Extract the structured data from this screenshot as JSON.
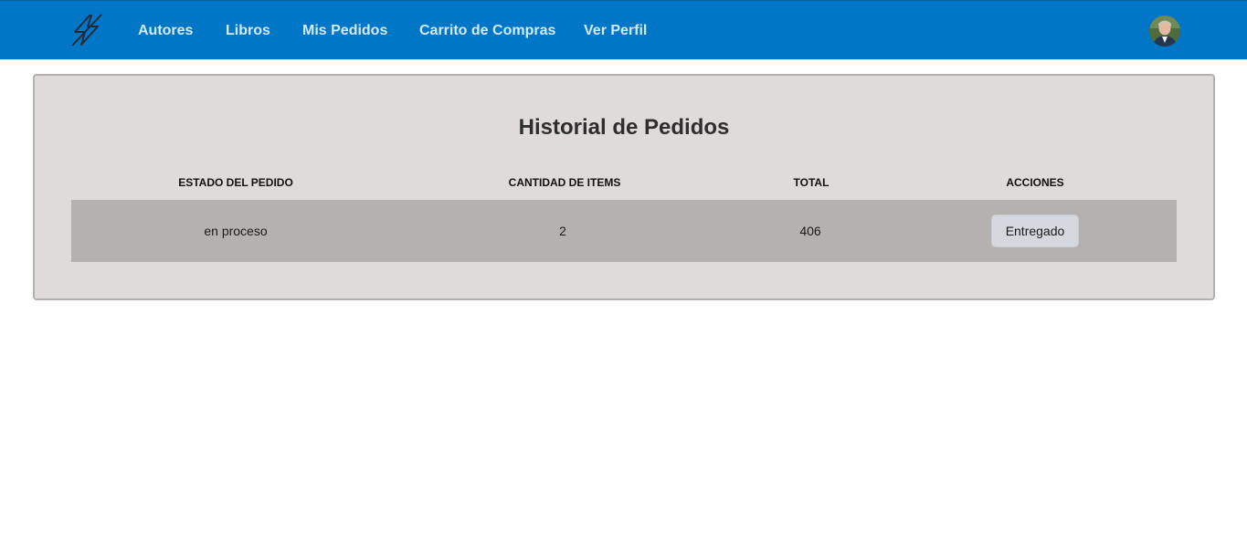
{
  "nav": {
    "logo_icon": "lightning-bolt-icon",
    "links": [
      "Autores",
      "Libros",
      "Mis Pedidos",
      "Carrito de Compras",
      "Ver Perfil"
    ],
    "avatar_icon": "user-avatar-icon"
  },
  "orders": {
    "title": "Historial de Pedidos",
    "columns": [
      "ESTADO DEL PEDIDO",
      "CANTIDAD DE ITEMS",
      "TOTAL",
      "ACCIONES"
    ],
    "rows": [
      {
        "status": "en proceso",
        "items": "2",
        "total": "406",
        "action_label": "Entregado"
      }
    ]
  },
  "colors": {
    "navbar": "#0077c6",
    "panel": "#dfdbdb",
    "row": "#b5b1b0",
    "button": "#d5d8df"
  }
}
